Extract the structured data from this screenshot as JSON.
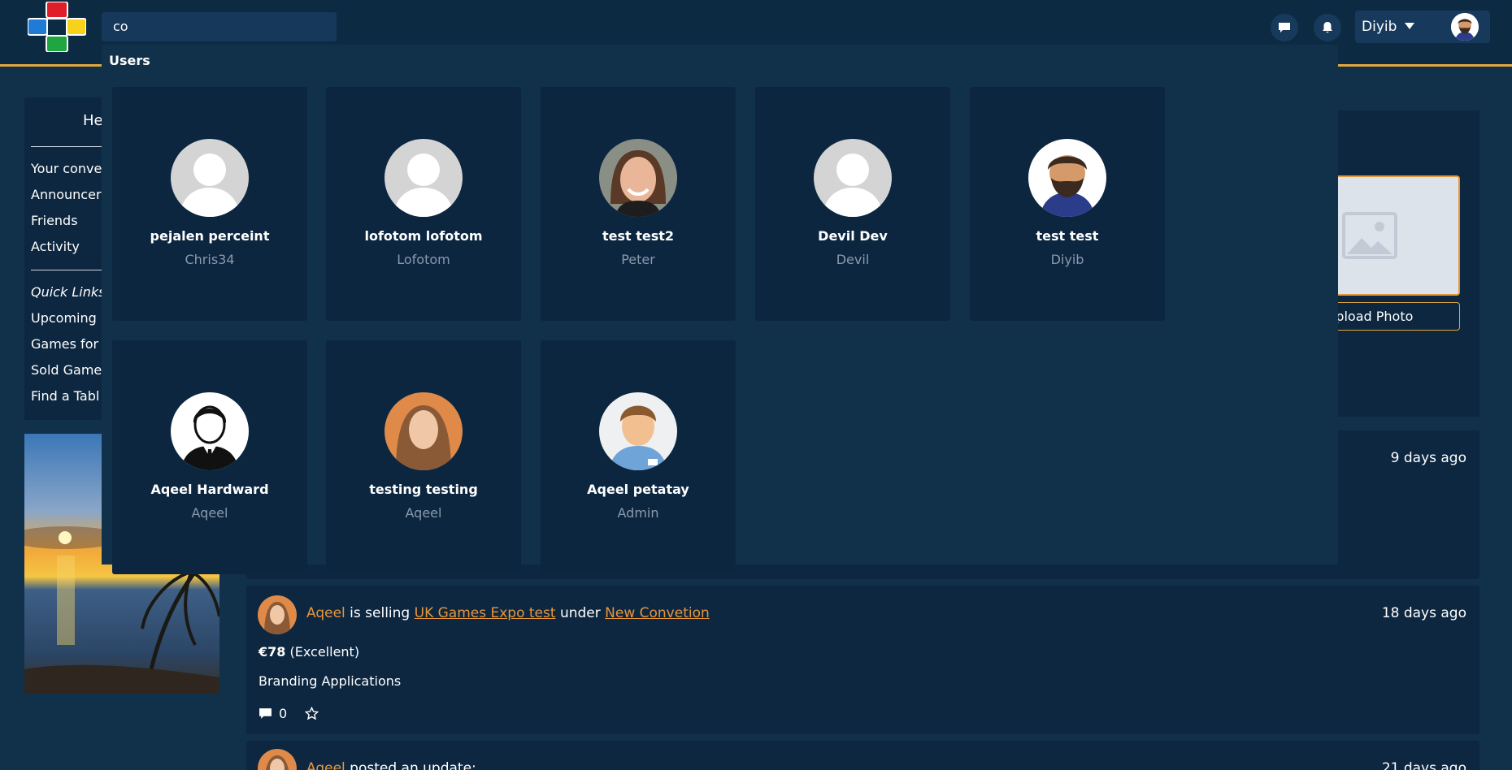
{
  "search": {
    "value": "co"
  },
  "header": {
    "username": "Diyib"
  },
  "sidebar": {
    "heading": "He",
    "links": [
      "Your conve",
      "Announcer",
      "Friends",
      "Activity"
    ],
    "quick_links_label": "Quick Links",
    "quick_links": [
      "Upcoming",
      "Games for",
      "Sold Game",
      "Find a Tabl"
    ]
  },
  "profile": {
    "upload_label": "Upload Photo"
  },
  "dropdown": {
    "heading": "Users",
    "users": [
      {
        "name": "pejalen perceint",
        "handle": "Chris34"
      },
      {
        "name": "lofotom lofotom",
        "handle": "Lofotom"
      },
      {
        "name": "test test2",
        "handle": "Peter"
      },
      {
        "name": "Devil Dev",
        "handle": "Devil"
      },
      {
        "name": "test test",
        "handle": "Diyib"
      },
      {
        "name": "Aqeel Hardward",
        "handle": "Aqeel"
      },
      {
        "name": "testing testing",
        "handle": "Aqeel"
      },
      {
        "name": "Aqeel petatay",
        "handle": "Admin"
      }
    ]
  },
  "feed": [
    {
      "time": "9 days ago"
    },
    {
      "time": "18 days ago",
      "user": "Aqeel",
      "text1": "is selling",
      "item": "UK Games Expo test",
      "text2": "under",
      "category": "New Convetion",
      "price": "€78",
      "condition": "(Excellent)",
      "description": "Branding Applications",
      "comment_count": "0"
    },
    {
      "time": "21 days ago",
      "user": "Aqeel",
      "action": "posted an update:"
    }
  ],
  "colors": {
    "accent": "#e8963a",
    "background": "#11304a",
    "card": "#0d2740"
  }
}
